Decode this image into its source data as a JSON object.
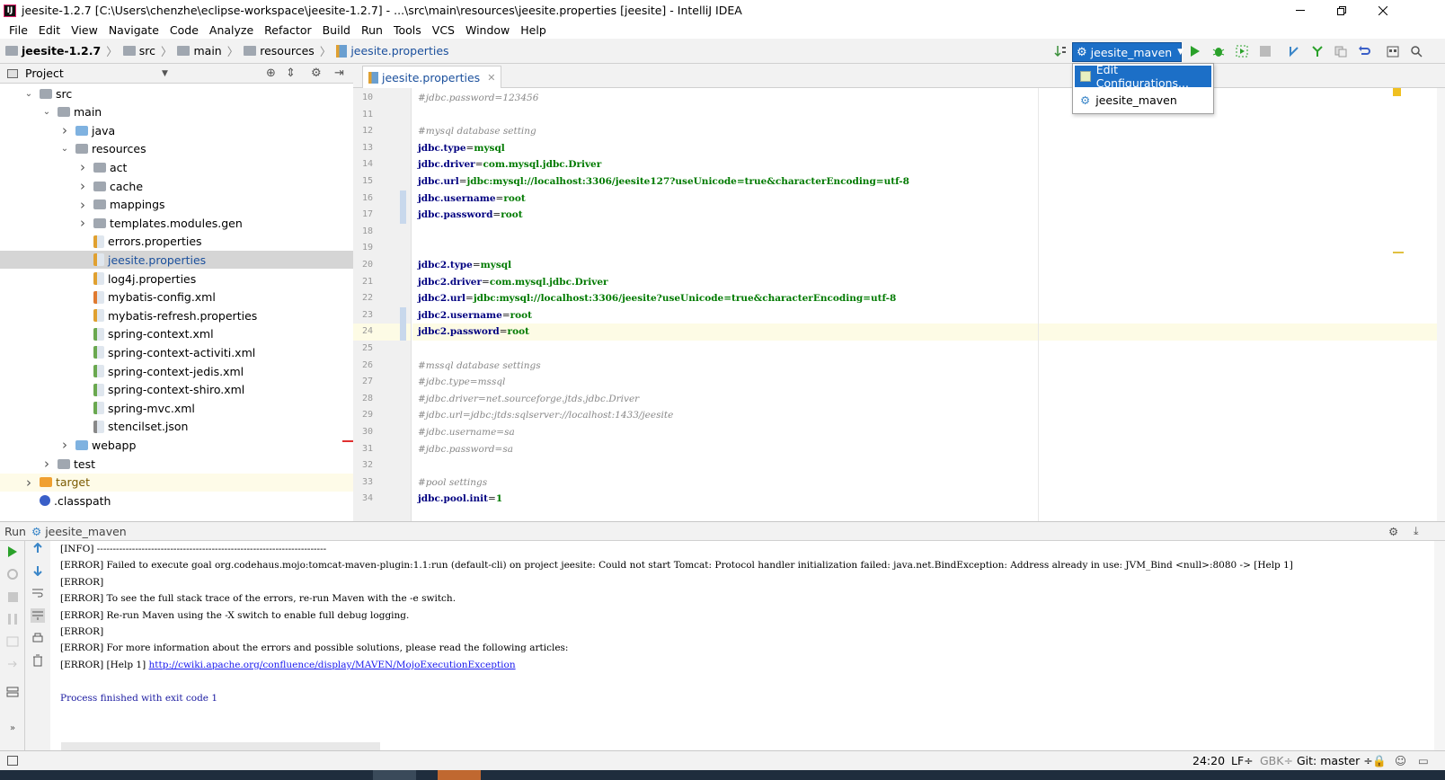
{
  "window": {
    "title": "jeesite-1.2.7 [C:\\Users\\chenzhe\\eclipse-workspace\\jeesite-1.2.7] - ...\\src\\main\\resources\\jeesite.properties [jeesite] - IntelliJ IDEA"
  },
  "menu": [
    "File",
    "Edit",
    "View",
    "Navigate",
    "Code",
    "Analyze",
    "Refactor",
    "Build",
    "Run",
    "Tools",
    "VCS",
    "Window",
    "Help"
  ],
  "breadcrumb": [
    "jeesite-1.2.7",
    "src",
    "main",
    "resources",
    "jeesite.properties"
  ],
  "run_config": {
    "selected": "jeesite_maven",
    "menu": [
      "Edit Configurations...",
      "jeesite_maven"
    ]
  },
  "project_panel": {
    "title": "Project"
  },
  "tree": [
    {
      "label": "src",
      "type": "folder",
      "indent": 1,
      "expanded": true
    },
    {
      "label": "main",
      "type": "folder",
      "indent": 2,
      "expanded": true
    },
    {
      "label": "java",
      "type": "folder-blue",
      "indent": 3,
      "expanded": false
    },
    {
      "label": "resources",
      "type": "folder",
      "indent": 3,
      "expanded": true
    },
    {
      "label": "act",
      "type": "folder",
      "indent": 4,
      "expanded": false
    },
    {
      "label": "cache",
      "type": "folder",
      "indent": 4,
      "expanded": false
    },
    {
      "label": "mappings",
      "type": "folder",
      "indent": 4,
      "expanded": false
    },
    {
      "label": "templates.modules.gen",
      "type": "folder",
      "indent": 4,
      "expanded": false
    },
    {
      "label": "errors.properties",
      "type": "properties",
      "indent": 4
    },
    {
      "label": "jeesite.properties",
      "type": "properties",
      "indent": 4,
      "selected": true
    },
    {
      "label": "log4j.properties",
      "type": "properties",
      "indent": 4
    },
    {
      "label": "mybatis-config.xml",
      "type": "xml",
      "indent": 4
    },
    {
      "label": "mybatis-refresh.properties",
      "type": "properties",
      "indent": 4
    },
    {
      "label": "spring-context.xml",
      "type": "spring",
      "indent": 4
    },
    {
      "label": "spring-context-activiti.xml",
      "type": "spring",
      "indent": 4
    },
    {
      "label": "spring-context-jedis.xml",
      "type": "spring",
      "indent": 4
    },
    {
      "label": "spring-context-shiro.xml",
      "type": "spring",
      "indent": 4
    },
    {
      "label": "spring-mvc.xml",
      "type": "spring",
      "indent": 4
    },
    {
      "label": "stencilset.json",
      "type": "json",
      "indent": 4
    },
    {
      "label": "webapp",
      "type": "folder-blue",
      "indent": 3,
      "expanded": false
    },
    {
      "label": "test",
      "type": "folder",
      "indent": 2,
      "expanded": false
    },
    {
      "label": "target",
      "type": "folder-orange",
      "indent": 1,
      "expanded": false,
      "highlight": true
    },
    {
      "label": ".classpath",
      "type": "classpath",
      "indent": 1
    }
  ],
  "editor": {
    "tab": "jeesite.properties",
    "current_line": 24,
    "lines": [
      {
        "n": "10",
        "text": "#jdbc.password=123456",
        "kind": "comment"
      },
      {
        "n": "11",
        "text": "",
        "kind": "blank"
      },
      {
        "n": "12",
        "text": "#mysql database setting",
        "kind": "comment"
      },
      {
        "n": "13",
        "key": "jdbc.type",
        "val": "mysql",
        "kind": "kv"
      },
      {
        "n": "14",
        "key": "jdbc.driver",
        "val": "com.mysql.jdbc.Driver",
        "kind": "kv"
      },
      {
        "n": "15",
        "key": "jdbc.url",
        "val": "jdbc:mysql://localhost:3306/jeesite127?useUnicode=true&characterEncoding=utf-8",
        "kind": "kv"
      },
      {
        "n": "16",
        "key": "jdbc.username",
        "val": "root",
        "kind": "kv"
      },
      {
        "n": "17",
        "key": "jdbc.password",
        "val": "root",
        "kind": "kv"
      },
      {
        "n": "18",
        "text": "",
        "kind": "blank"
      },
      {
        "n": "19",
        "text": "",
        "kind": "blank"
      },
      {
        "n": "20",
        "key": "jdbc2.type",
        "val": "mysql",
        "kind": "kv"
      },
      {
        "n": "21",
        "key": "jdbc2.driver",
        "val": "com.mysql.jdbc.Driver",
        "kind": "kv"
      },
      {
        "n": "22",
        "key": "jdbc2.url",
        "val": "jdbc:mysql://localhost:3306/jeesite?useUnicode=true&characterEncoding=utf-8",
        "kind": "kv"
      },
      {
        "n": "23",
        "key": "jdbc2.username",
        "val": "root",
        "kind": "kv"
      },
      {
        "n": "24",
        "key": "jdbc2.password",
        "val": "root",
        "kind": "kv"
      },
      {
        "n": "25",
        "text": "",
        "kind": "blank"
      },
      {
        "n": "26",
        "text": "#mssql database settings",
        "kind": "comment"
      },
      {
        "n": "27",
        "text": "#jdbc.type=mssql",
        "kind": "comment"
      },
      {
        "n": "28",
        "text": "#jdbc.driver=net.sourceforge.jtds.jdbc.Driver",
        "kind": "comment"
      },
      {
        "n": "29",
        "text": "#jdbc.url=jdbc:jtds:sqlserver://localhost:1433/jeesite",
        "kind": "comment"
      },
      {
        "n": "30",
        "text": "#jdbc.username=sa",
        "kind": "comment"
      },
      {
        "n": "31",
        "text": "#jdbc.password=sa",
        "kind": "comment"
      },
      {
        "n": "32",
        "text": "",
        "kind": "blank"
      },
      {
        "n": "33",
        "text": "#pool settings",
        "kind": "comment"
      },
      {
        "n": "34",
        "key": "jdbc.pool.init",
        "val": "1",
        "kind": "kv"
      }
    ]
  },
  "run_panel": {
    "label": "Run",
    "config": "jeesite_maven",
    "console": [
      {
        "text": "[INFO] ------------------------------------------------------------------------",
        "kind": "normal"
      },
      {
        "text": "[ERROR] Failed to execute goal org.codehaus.mojo:tomcat-maven-plugin:1.1:run (default-cli) on project jeesite: Could not start Tomcat: Protocol handler initialization failed: java.net.BindException: Address already in use: JVM_Bind <null>:8080 -> [Help 1]",
        "kind": "normal"
      },
      {
        "text": "[ERROR]",
        "kind": "normal"
      },
      {
        "text": "[ERROR] To see the full stack trace of the errors, re-run Maven with the -e switch.",
        "kind": "normal"
      },
      {
        "text": "[ERROR] Re-run Maven using the -X switch to enable full debug logging.",
        "kind": "normal"
      },
      {
        "text": "[ERROR]",
        "kind": "normal"
      },
      {
        "text": "[ERROR] For more information about the errors and possible solutions, please read the following articles:",
        "kind": "normal"
      },
      {
        "prefix": "[ERROR] [Help 1] ",
        "link": "http://cwiki.apache.org/confluence/display/MAVEN/MojoExecutionException",
        "kind": "link"
      },
      {
        "text": "",
        "kind": "blank"
      },
      {
        "text": "Process finished with exit code 1",
        "kind": "exit"
      }
    ]
  },
  "status_bar": {
    "position": "24:20",
    "line_sep": "LF÷",
    "encoding": "GBK÷",
    "vcs": "Git: master ÷"
  },
  "colors": {
    "accent": "#1c6fc7",
    "run_green": "#2aa12a",
    "selection": "#d5d5d5"
  }
}
